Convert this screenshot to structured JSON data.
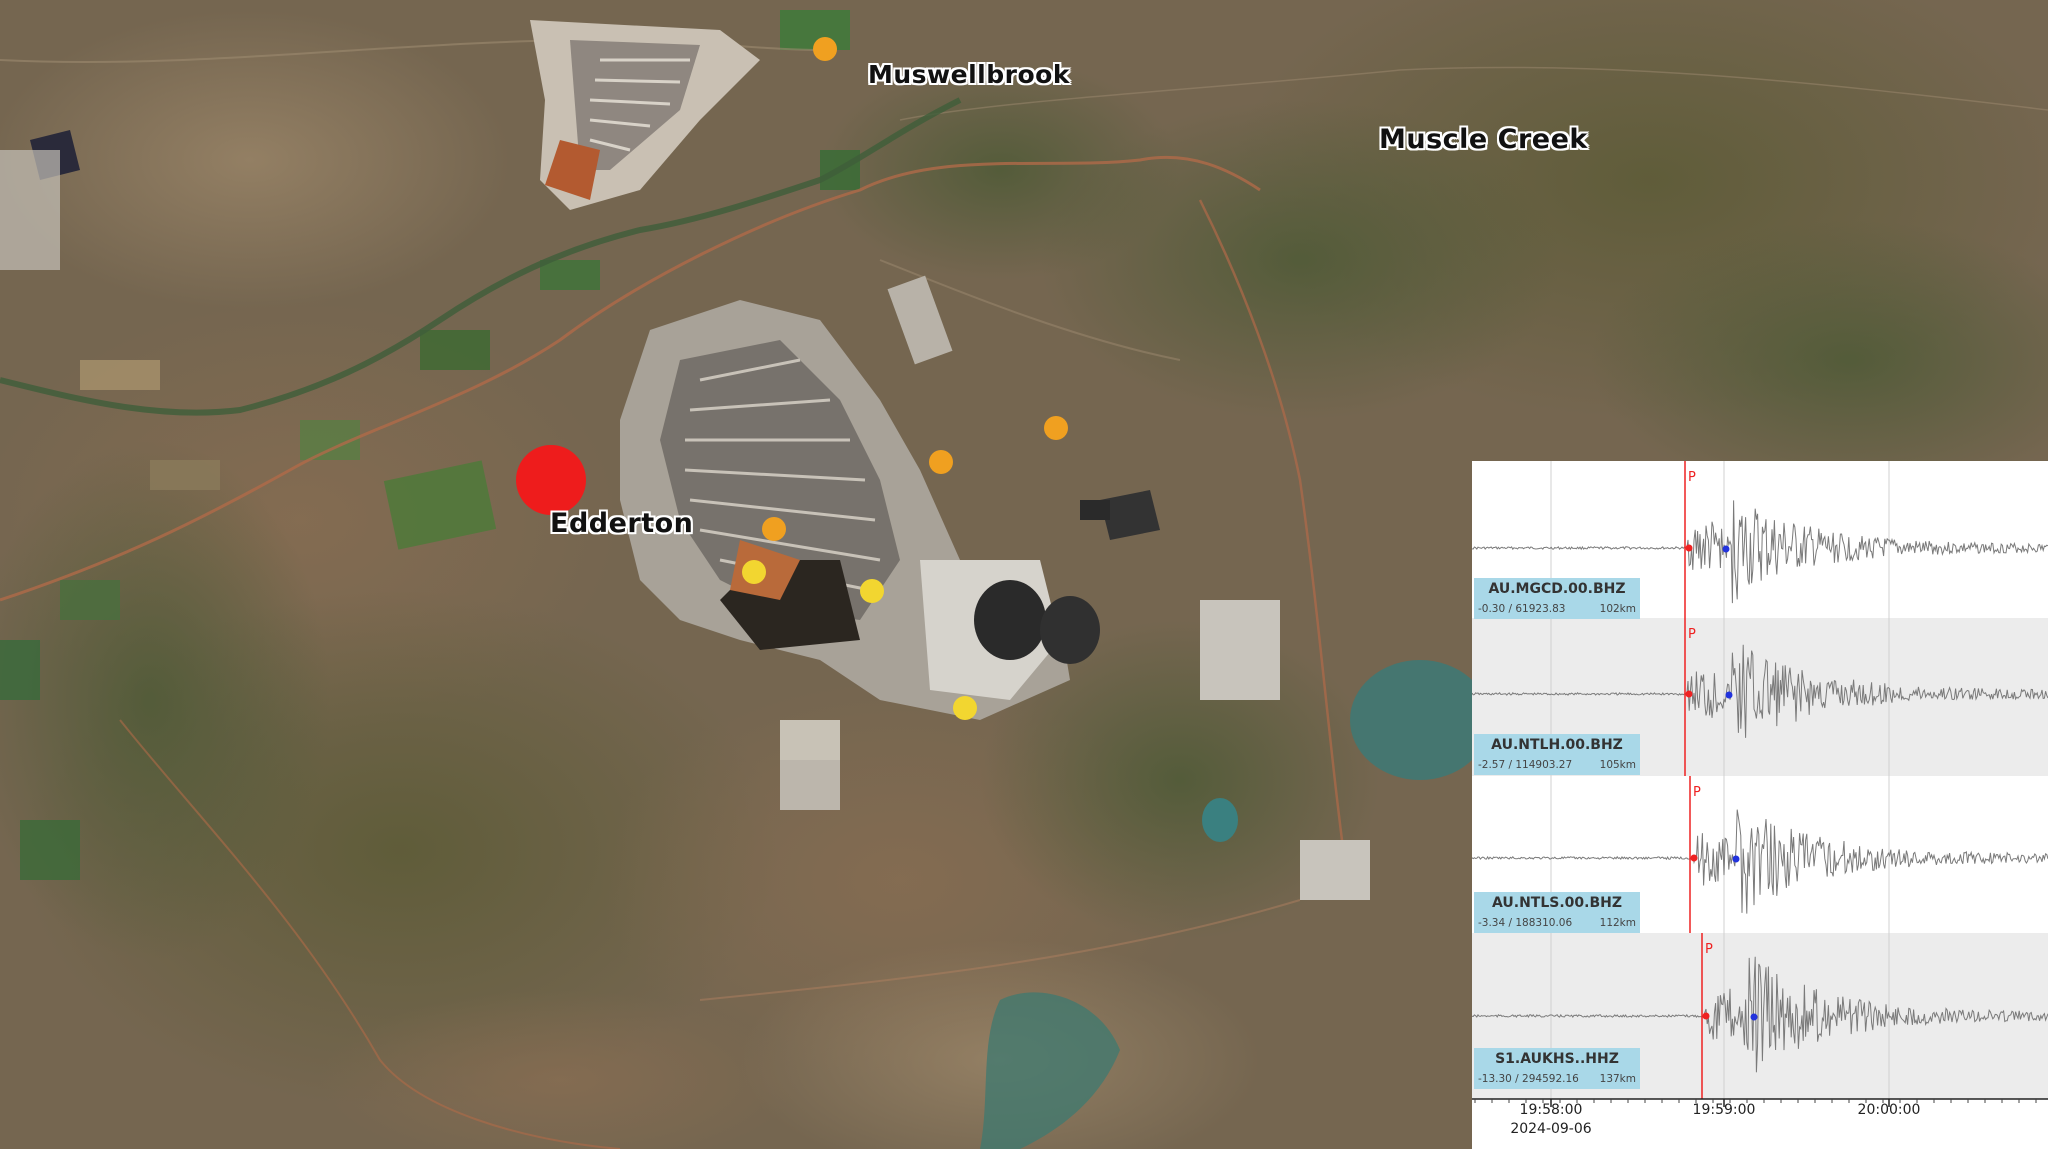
{
  "map": {
    "labels": {
      "muswellbrook": "Muswellbrook",
      "muscle_creek": "Muscle Creek",
      "edderton": "Edderton"
    },
    "colors": {
      "epicenter": "#ee1c1c",
      "event_orange": "#f0a020",
      "event_yellow": "#f2d630"
    }
  },
  "seismogram": {
    "traces": [
      {
        "station": "AU.MGCD.00.BHZ",
        "stats": "-0.30 / 61923.83",
        "distance": "102km",
        "phase": "P"
      },
      {
        "station": "AU.NTLH.00.BHZ",
        "stats": "-2.57 / 114903.27",
        "distance": "105km",
        "phase": "P"
      },
      {
        "station": "AU.NTLS.00.BHZ",
        "stats": "-3.34 / 188310.06",
        "distance": "112km",
        "phase": "P"
      },
      {
        "station": "S1.AUKHS..HHZ",
        "stats": "-13.30 / 294592.16",
        "distance": "137km",
        "phase": "P"
      }
    ],
    "time_axis": {
      "ticks": [
        "19:58:00",
        "19:59:00",
        "20:00:00"
      ],
      "date": "2024-09-06"
    }
  }
}
